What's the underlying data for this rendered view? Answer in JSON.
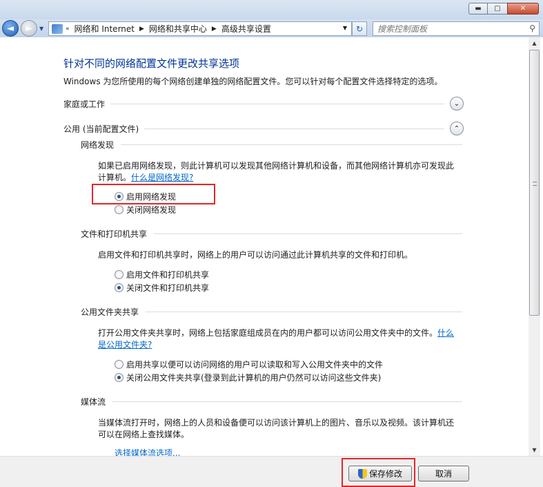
{
  "window": {
    "minimize_glyph": "▬",
    "maximize_glyph": "▢",
    "close_glyph": "✕"
  },
  "nav": {
    "back_glyph": "◄",
    "forward_glyph": "►",
    "history_glyph": "▼",
    "breadcrumbs": [
      "网络和 Internet",
      "网络和共享中心",
      "高级共享设置"
    ],
    "refresh_glyph": "↻",
    "search_placeholder": "搜索控制面板"
  },
  "page": {
    "title": "针对不同的网络配置文件更改共享选项",
    "intro": "Windows 为您所使用的每个网络创建单独的网络配置文件。您可以针对每个配置文件选择特定的选项。",
    "profiles": [
      {
        "label": "家庭或工作",
        "expanded": false,
        "toggle_glyph": "⌄"
      },
      {
        "label": "公用 (当前配置文件)",
        "expanded": true,
        "toggle_glyph": "⌃"
      }
    ],
    "network_discovery": {
      "heading": "网络发现",
      "description": "如果已启用网络发现，则此计算机可以发现其他网络计算机和设备，而其他网络计算机亦可发现此计算机。",
      "link": "什么是网络发现?",
      "options": [
        {
          "label": "启用网络发现",
          "checked": true
        },
        {
          "label": "关闭网络发现",
          "checked": false
        }
      ]
    },
    "file_printer_sharing": {
      "heading": "文件和打印机共享",
      "description": "启用文件和打印机共享时，网络上的用户可以访问通过此计算机共享的文件和打印机。",
      "options": [
        {
          "label": "启用文件和打印机共享",
          "checked": false
        },
        {
          "label": "关闭文件和打印机共享",
          "checked": true
        }
      ]
    },
    "public_folder_sharing": {
      "heading": "公用文件夹共享",
      "description": "打开公用文件夹共享时，网络上包括家庭组成员在内的用户都可以访问公用文件夹中的文件。",
      "link": "什么是公用文件夹?",
      "options": [
        {
          "label": "启用共享以便可以访问网络的用户可以读取和写入公用文件夹中的文件",
          "checked": false
        },
        {
          "label": "关闭公用文件夹共享(登录到此计算机的用户仍然可以访问这些文件夹)",
          "checked": true
        }
      ]
    },
    "media_streaming": {
      "heading": "媒体流",
      "description": "当媒体流打开时，网络上的人员和设备便可以访问该计算机上的图片、音乐以及视频。该计算机还可以在网络上查找媒体。",
      "link": "选择媒体流选项..."
    }
  },
  "footer": {
    "save_label": "保存修改",
    "cancel_label": "取消"
  },
  "colors": {
    "title": "#003399",
    "link": "#0066cc",
    "highlight": "#e0262a"
  }
}
